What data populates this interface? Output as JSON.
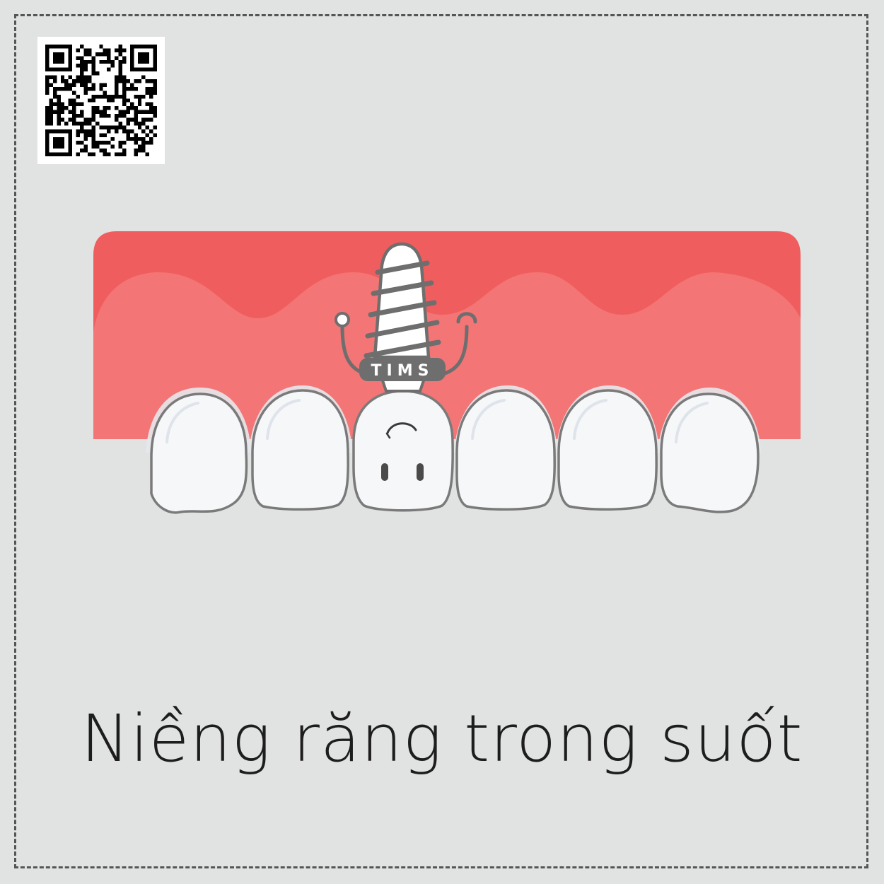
{
  "logo": {
    "brand_text": "TIMS"
  },
  "caption": {
    "text": "Niềng răng trong suốt"
  },
  "colors": {
    "background": "#e1e3e2",
    "frame_dash": "#555555",
    "gum_dark": "#f05d5e",
    "gum_light": "#f37575",
    "tooth_fill": "#f6f7f9",
    "tooth_outline": "#7a7a7a",
    "implant_gray": "#6e6e6e"
  },
  "icons": {
    "qr": "qr-code-icon",
    "mascot": "dental-implant-mascot-icon",
    "tooth": "tooth-icon"
  }
}
